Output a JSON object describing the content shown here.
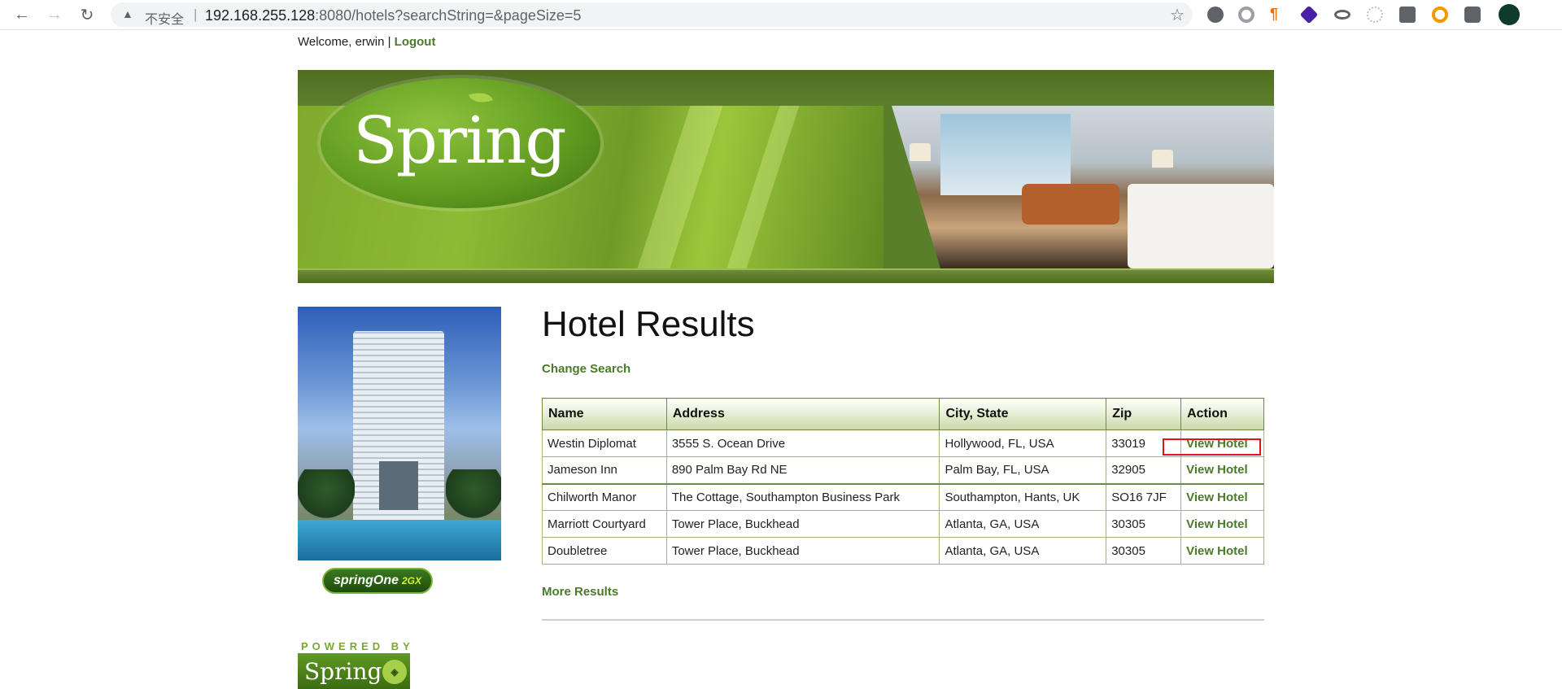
{
  "browser": {
    "security_label": "不安全",
    "url_host": "192.168.255.128",
    "url_rest": ":8080/hotels?searchString=&pageSize=5"
  },
  "header": {
    "welcome_text": "Welcome, erwin | ",
    "logout_label": "Logout"
  },
  "banner": {
    "logo_text": "Spring"
  },
  "sidebar": {
    "badge_text": "springOne",
    "badge_accent": "2GX"
  },
  "main": {
    "title": "Hotel Results",
    "change_search_label": "Change Search",
    "more_results_label": "More Results"
  },
  "table": {
    "headers": [
      "Name",
      "Address",
      "City, State",
      "Zip",
      "Action"
    ],
    "rows": [
      [
        "Westin Diplomat",
        "3555 S. Ocean Drive",
        "Hollywood, FL, USA",
        "33019",
        "View Hotel"
      ],
      [
        "Jameson Inn",
        "890 Palm Bay Rd NE",
        "Palm Bay, FL, USA",
        "32905",
        "View Hotel"
      ],
      [
        "Chilworth Manor",
        "The Cottage, Southampton Business Park",
        "Southampton, Hants, UK",
        "SO16 7JF",
        "View Hotel"
      ],
      [
        "Marriott Courtyard",
        "Tower Place, Buckhead",
        "Atlanta, GA, USA",
        "30305",
        "View Hotel"
      ],
      [
        "Doubletree",
        "Tower Place, Buckhead",
        "Atlanta, GA, USA",
        "30305",
        "View Hotel"
      ]
    ]
  },
  "footer": {
    "powered_by": "POWERED BY",
    "badge_text": "Spring"
  },
  "colors": {
    "link_green": "#4b7a2a",
    "highlight_red": "#e0151a"
  }
}
